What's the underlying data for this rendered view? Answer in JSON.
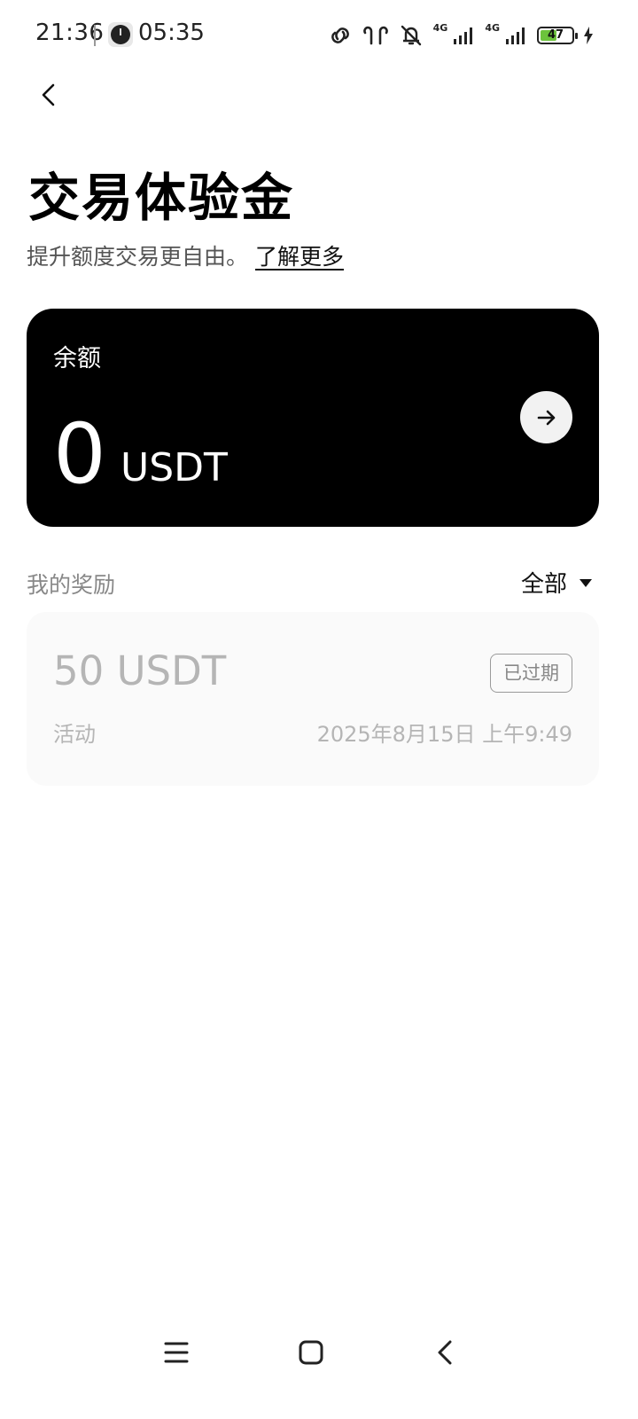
{
  "status_bar": {
    "time": "21:36",
    "secondary_time": "05:35",
    "network_1": "4G",
    "network_2": "4G",
    "battery": "47",
    "battery_level_percent": 47,
    "icons": [
      "link-icon",
      "earbuds-icon",
      "mute-icon",
      "signal-icon",
      "signal-icon",
      "battery-icon",
      "charging-icon"
    ]
  },
  "header": {
    "back_icon": "chevron-left-icon",
    "title": "交易体验金",
    "subtitle": "提升额度交易更自由。",
    "learn_more": "了解更多"
  },
  "balance_card": {
    "label": "余额",
    "value": "0",
    "unit": "USDT",
    "action_icon": "arrow-right-icon"
  },
  "rewards": {
    "title": "我的奖励",
    "filter_label": "全部",
    "items": [
      {
        "amount": "50 USDT",
        "status": "已过期",
        "type": "活动",
        "date": "2025年8月15日 上午9:49"
      }
    ]
  },
  "nav_bar": {
    "icons": [
      "menu-icon",
      "home-icon",
      "back-icon"
    ]
  },
  "colors": {
    "card_background": "#000000",
    "accent_battery": "#6cc33c",
    "muted_text": "#b5b5b5"
  }
}
